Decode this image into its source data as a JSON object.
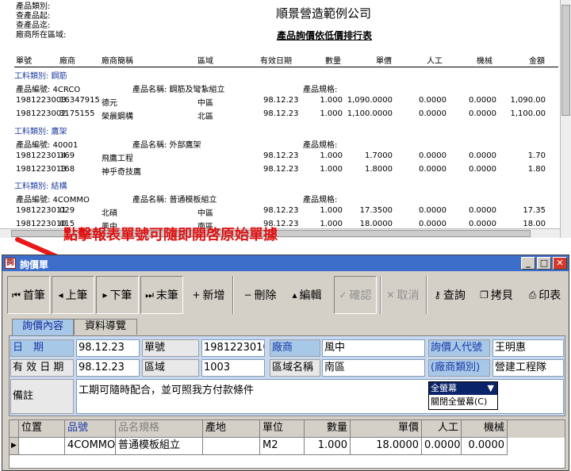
{
  "report": {
    "header_labels": [
      "產品類別:",
      "查產品起:",
      "查產品迄:",
      "廠商所在區域:"
    ],
    "company": "順景營造範例公司",
    "title": "產品詢價依低價排行表",
    "columns": [
      "單號",
      "廠商",
      "廠商簡稱",
      "區域",
      "有效日期",
      "數量",
      "單價",
      "人工",
      "機械",
      "金額"
    ],
    "groups": [
      {
        "category": "工料類別: 鋼筋",
        "code": "產品編號: 4CRCO",
        "name": "產品名稱: 鋼筋及彎紮組立",
        "spec": "產品規格:",
        "rows": [
          [
            "1981223003",
            "16347915",
            "德元",
            "中區",
            "98.12.23",
            "1.000",
            "1,090.0000",
            "0.0000",
            "0.0000",
            "1,090.00"
          ],
          [
            "1981223002",
            "3175155",
            "榮晨鋼構",
            "北區",
            "98.12.23",
            "1.000",
            "1,100.0000",
            "0.0000",
            "0.0000",
            "1,100.00"
          ]
        ]
      },
      {
        "category": "工料類別: 鷹架",
        "code": "產品編號: 40001",
        "name": "產品名稱: 外部鷹架",
        "spec": "產品規格:",
        "rows": [
          [
            "1981223014",
            "169",
            "飛鷹工程",
            "",
            "98.12.23",
            "1.000",
            "1.7000",
            "0.0000",
            "0.0000",
            "1.70"
          ],
          [
            "1981223013",
            "168",
            "神乎奇技鷹",
            "",
            "98.12.23",
            "1.000",
            "1.8000",
            "0.0000",
            "0.0000",
            "1.80"
          ]
        ]
      },
      {
        "category": "工料類別: 結構",
        "code": "產品編號: 4COMMO",
        "name": "產品名稱: 普通模板組立",
        "spec": "產品規格:",
        "rows": [
          [
            "1981223011",
            "029",
            "北碩",
            "中區",
            "98.12.23",
            "1.000",
            "17.3500",
            "0.0000",
            "0.0000",
            "17.35"
          ],
          [
            "1981223010",
            "015",
            "風中",
            "南區",
            "98.12.23",
            "1.000",
            "18.0000",
            "0.0000",
            "0.0000",
            "18.00"
          ]
        ]
      }
    ]
  },
  "annotation": "點擊報表單號可隨即開啓原始單據",
  "window": {
    "title": "詢價單",
    "toolbar": [
      {
        "icon": "first-record-icon",
        "glyph": "⏮",
        "label": "首筆",
        "state": "pressed"
      },
      {
        "icon": "prev-record-icon",
        "glyph": "◂",
        "label": "上筆",
        "state": "pressed"
      },
      {
        "icon": "next-record-icon",
        "glyph": "▸",
        "label": "下筆",
        "state": "pressed"
      },
      {
        "icon": "last-record-icon",
        "glyph": "⏭",
        "label": "末筆",
        "state": "pressed"
      },
      {
        "icon": "add-icon",
        "glyph": "+",
        "label": "新增",
        "state": "normal"
      },
      {
        "icon": "delete-icon",
        "glyph": "−",
        "label": "刪除",
        "state": "normal"
      },
      {
        "icon": "edit-icon",
        "glyph": "▴",
        "label": "編輯",
        "state": "normal"
      },
      {
        "icon": "confirm-icon",
        "glyph": "✓",
        "label": "確認",
        "state": "disabled-pressed"
      },
      {
        "icon": "cancel-icon",
        "glyph": "✕",
        "label": "取消",
        "state": "disabled"
      },
      {
        "icon": "key-icon",
        "glyph": "⚷",
        "label": "查詢",
        "state": "normal"
      },
      {
        "icon": "copy-icon",
        "glyph": "❐",
        "label": "拷貝",
        "state": "normal"
      },
      {
        "icon": "printer-icon",
        "glyph": "⎙",
        "label": "印表",
        "state": "normal"
      }
    ],
    "tabs": [
      "詢價內容",
      "資料導覽"
    ],
    "form": {
      "date_label": "日　期",
      "date": "98.12.23",
      "doc_no_label": "單號",
      "doc_no": "1981223010",
      "vendor_label": "廠商",
      "vendor": "風中",
      "inquirer_label": "詢價人代號",
      "inquirer": "王明惠",
      "valid_date_label": "有 效 日 期",
      "valid_date": "98.12.23",
      "region_label": "區域",
      "region": "1003",
      "region_name_label": "區域名稱",
      "region_name": "南區",
      "vendor_type_label": "(廠商類別)",
      "vendor_type": "營建工程隊",
      "remark_label": "備註",
      "remark": "工期可隨時配合，並可照我方付款條件"
    },
    "dropdown": {
      "selected": "全螢幕",
      "option": "關閉全螢幕(C)"
    },
    "grid": {
      "columns": [
        "位置",
        "品號",
        "品名規格",
        "產地",
        "單位",
        "數量",
        "單價",
        "人工",
        "機械"
      ],
      "rows": [
        [
          "",
          "4COMMO",
          "普通模板組立",
          "",
          "M2",
          "1.000",
          "18.0000",
          "0.0000",
          "0.0000"
        ]
      ]
    }
  },
  "colors": {
    "title_bar": "#3c6dc8",
    "label_blue": "#1a3aa8",
    "annotation_red": "#e01010",
    "panel": "#c8d8f0"
  }
}
